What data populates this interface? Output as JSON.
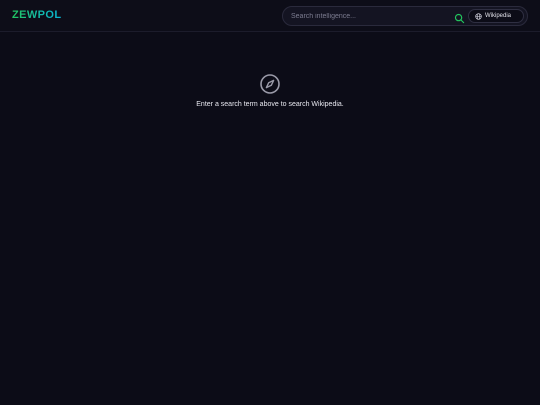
{
  "app": {
    "logo": "ZEWPOL"
  },
  "search": {
    "placeholder": "Search intelligence...",
    "value": "",
    "source_label": "Wikipedia"
  },
  "empty_state": {
    "message": "Enter a search term above to search Wikipedia."
  },
  "colors": {
    "background": "#0c0c17",
    "accent_green": "#22c55e",
    "accent_cyan": "#06b6d4",
    "search_icon": "#22c55e"
  },
  "icons": {
    "search_button": "search-icon",
    "source": "globe-icon",
    "empty_state": "compass-icon"
  }
}
